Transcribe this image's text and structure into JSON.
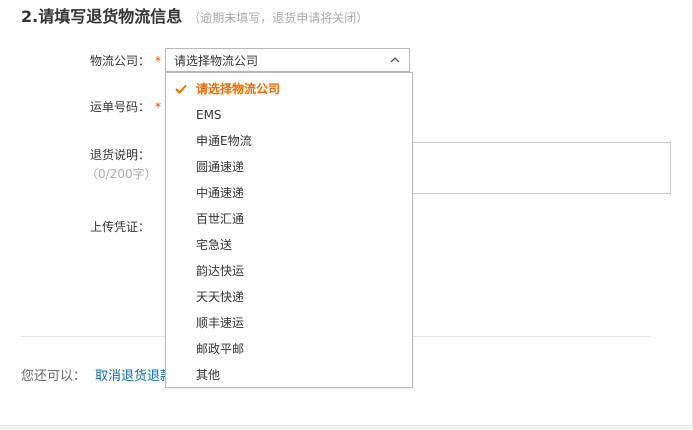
{
  "section": {
    "title": "2.请填写退货物流信息",
    "note": "（逾期未填写，退货申请将关闭）"
  },
  "form": {
    "carrier_label": "物流公司：",
    "carrier_required": "*",
    "carrier_value": "请选择物流公司",
    "tracking_label": "运单号码：",
    "tracking_required": "*",
    "note_label": "退货说明：",
    "note_counter": "（0/200字）",
    "upload_label": "上传凭证："
  },
  "dropdown": {
    "options": [
      "请选择物流公司",
      "EMS",
      "申通E物流",
      "圆通速递",
      "中通速递",
      "百世汇通",
      "宅急送",
      "韵达快运",
      "天天快递",
      "顺丰速运",
      "邮政平邮",
      "其他"
    ],
    "selected_index": 0
  },
  "footer": {
    "also_label": "您还可以：",
    "cancel_link": "取消退货退款申请"
  },
  "colors": {
    "accent": "#f26b00",
    "required": "#ff4400",
    "link": "#0e6fb5",
    "border": "#b8b8b8"
  },
  "icons": {
    "select_arrow": "chevron-up-icon",
    "selected_mark": "check-icon"
  }
}
